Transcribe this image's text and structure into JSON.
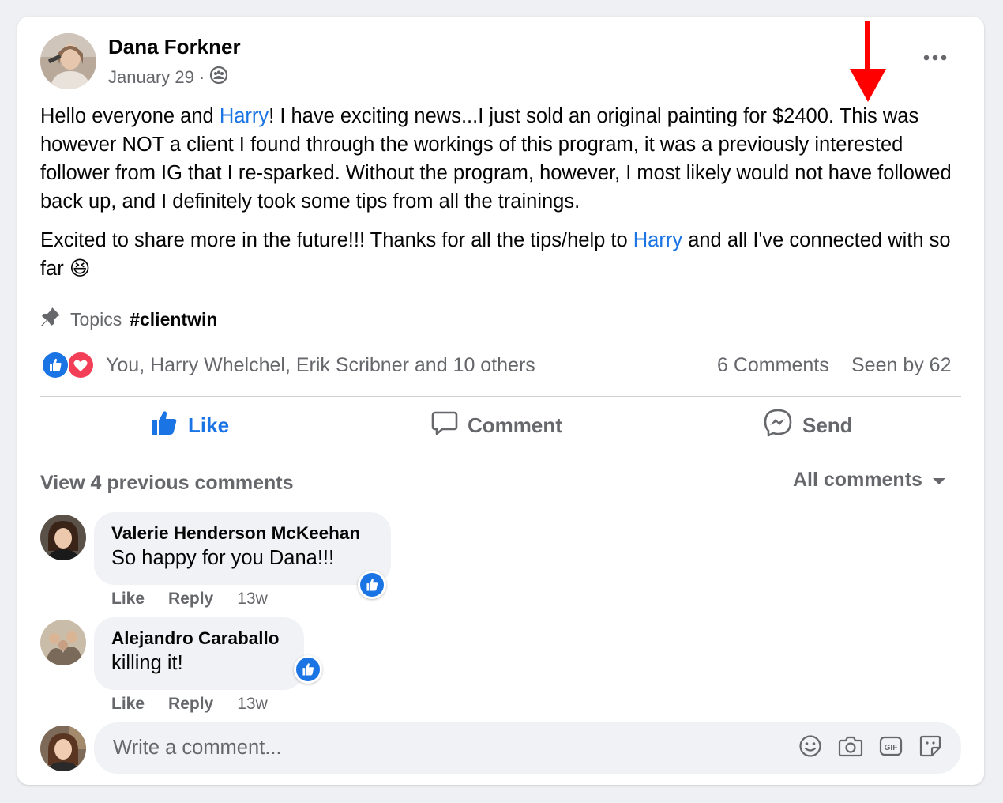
{
  "post": {
    "author": "Dana Forkner",
    "date": "January 29",
    "date_sep": "·",
    "paragraph1": {
      "pre": "Hello everyone and ",
      "mention": "Harry",
      "post": "! I have exciting news...I just sold an original painting for $2400. This was however NOT a client I found through the workings of this program, it was a previously interested follower from IG that I re-sparked. Without the program, however, I most likely would not have followed back up, and I definitely took some tips from all the trainings."
    },
    "paragraph2": {
      "pre": "Excited to share more in the future!!! Thanks for all the tips/help to ",
      "mention": "Harry",
      "post": " and all I've connected with so far ",
      "emoji": "😆"
    },
    "topics_label": "Topics",
    "topic_tag": "#clientwin",
    "reactions_text": "You, Harry Whelchel, Erik Scribner and 10 others",
    "comments_count": "6 Comments",
    "seen_by": "Seen by 62"
  },
  "actions": {
    "like": "Like",
    "comment": "Comment",
    "send": "Send"
  },
  "comments_section": {
    "view_previous": "View 4 previous comments",
    "sort_label": "All comments",
    "comments": [
      {
        "author": "Valerie Henderson McKeehan",
        "text": "So happy for you Dana!!!",
        "like": "Like",
        "reply": "Reply",
        "time": "13w"
      },
      {
        "author": "Alejandro Caraballo",
        "text": "killing it!",
        "like": "Like",
        "reply": "Reply",
        "time": "13w"
      }
    ],
    "write_placeholder": "Write a comment..."
  },
  "colors": {
    "accent": "#1b74e4",
    "annotation_arrow": "#ff0000",
    "love": "#f33e58"
  }
}
